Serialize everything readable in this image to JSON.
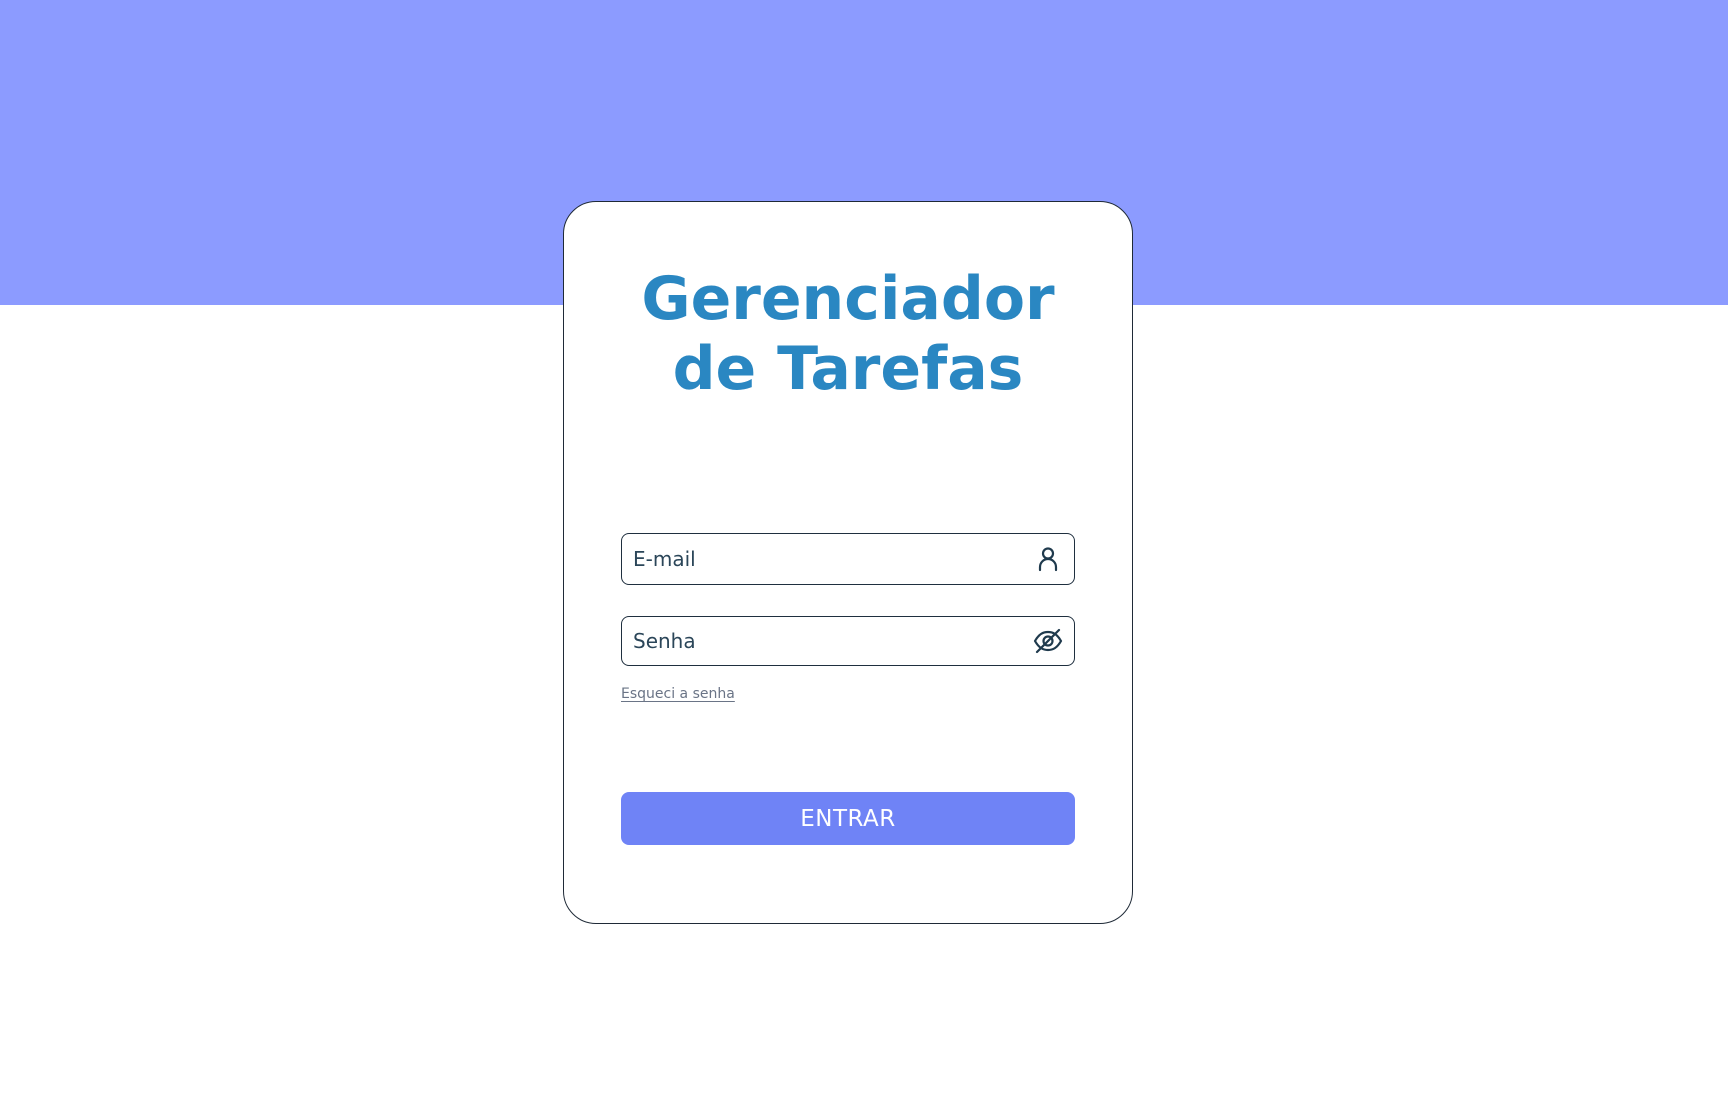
{
  "app": {
    "title_line1": "Gerenciador",
    "title_line2": "de Tarefas"
  },
  "form": {
    "email": {
      "placeholder": "E-mail",
      "value": "",
      "icon": "user-icon"
    },
    "password": {
      "placeholder": "Senha",
      "value": "",
      "icon": "eye-off-icon"
    },
    "forgot_label": "Esqueci a senha",
    "submit_label": "ENTRAR"
  },
  "colors": {
    "header_band": "#8c9bff",
    "title": "#2a87c2",
    "button": "#6f83f6",
    "border": "#1f2f3f",
    "link": "#6a7486"
  }
}
